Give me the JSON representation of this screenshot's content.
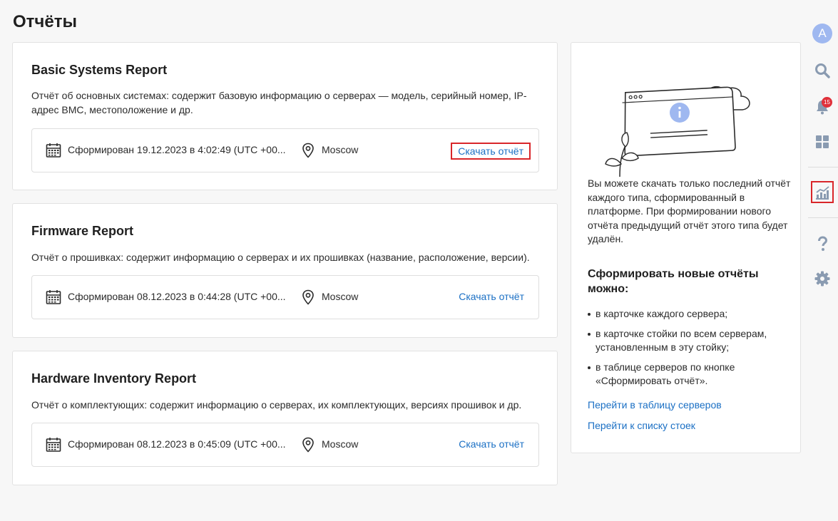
{
  "page_title": "Отчёты",
  "reports": [
    {
      "title": "Basic Systems Report",
      "description": "Отчёт об основных системах: содержит базовую информацию о серверах — модель, серийный номер, IP-адрес BMC, местоположение и др.",
      "generated": "Сформирован 19.12.2023 в 4:02:49 (UTC +00...",
      "location": "Moscow",
      "download_label": "Скачать отчёт"
    },
    {
      "title": "Firmware Report",
      "description": "Отчёт о прошивках: содержит информацию о серверах и их прошивках (название, расположение, версии).",
      "generated": "Сформирован 08.12.2023 в 0:44:28 (UTC +00...",
      "location": "Moscow",
      "download_label": "Скачать отчёт"
    },
    {
      "title": "Hardware Inventory Report",
      "description": "Отчёт о комплектующих: содержит информацию о серверах, их комплектующих, версиях прошивок и др.",
      "generated": "Сформирован 08.12.2023 в 0:45:09 (UTC +00...",
      "location": "Moscow",
      "download_label": "Скачать отчёт"
    }
  ],
  "info_panel": {
    "note": "Вы можете скачать только последний отчёт каждого типа, сформированный в платформе. При формировании нового отчёта предыдущий отчёт этого типа будет удалён.",
    "subheading": "Сформировать новые отчёты можно:",
    "bullets": [
      "в карточке каждого сервера;",
      "в карточке стойки по всем серверам, установленным в эту стойку;",
      "в таблице серверов по кнопке «Сформировать отчёт»."
    ],
    "link_servers": "Перейти в таблицу серверов",
    "link_racks": "Перейти к списку стоек"
  },
  "rail": {
    "avatar_letter": "A",
    "notifications_count": "15",
    "icons": [
      "search-icon",
      "bell-icon",
      "grid-icon",
      "chart-icon",
      "help-icon",
      "gear-icon"
    ]
  },
  "colors": {
    "link": "#1a6fc4",
    "highlight": "#d9262a",
    "rail_icon": "#8a9bb1",
    "avatar": "#9fb8f0"
  }
}
